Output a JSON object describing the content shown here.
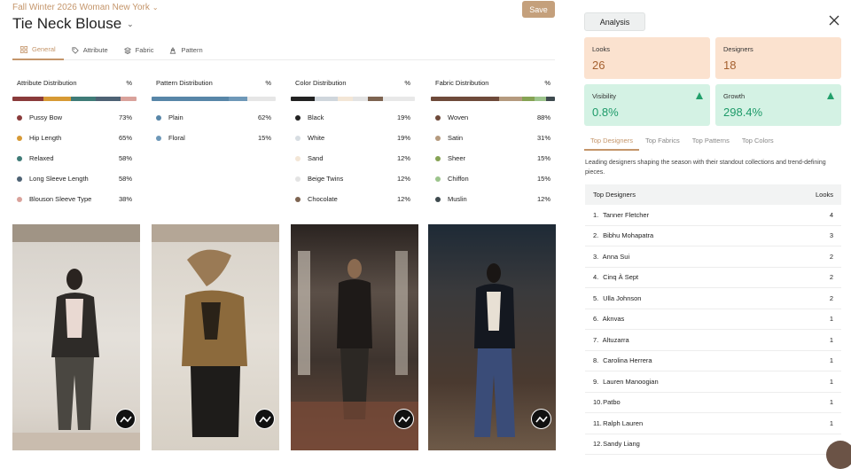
{
  "breadcrumb": "Fall Winter 2026 Woman New York",
  "title": "Tie Neck Blouse",
  "save_label": "Save",
  "tabs": [
    {
      "label": "General",
      "icon": "grid-icon",
      "active": true
    },
    {
      "label": "Attribute",
      "icon": "tag-icon",
      "active": false
    },
    {
      "label": "Fabric",
      "icon": "layers-icon",
      "active": false
    },
    {
      "label": "Pattern",
      "icon": "pattern-icon",
      "active": false
    }
  ],
  "distributions": [
    {
      "title": "Attribute Distribution",
      "pct_header": "%",
      "items": [
        {
          "label": "Pussy Bow",
          "value": "73%",
          "color": "#8a3b3b"
        },
        {
          "label": "Hip Length",
          "value": "65%",
          "color": "#d79a35"
        },
        {
          "label": "Relaxed",
          "value": "58%",
          "color": "#3f7b77"
        },
        {
          "label": "Long Sleeve Length",
          "value": "58%",
          "color": "#4e6274"
        },
        {
          "label": "Blouson Sleeve Type",
          "value": "38%",
          "color": "#d9a29b"
        }
      ]
    },
    {
      "title": "Pattern Distribution",
      "pct_header": "%",
      "items": [
        {
          "label": "Plain",
          "value": "62%",
          "color": "#5886a8"
        },
        {
          "label": "Floral",
          "value": "15%",
          "color": "#6e98b8"
        }
      ]
    },
    {
      "title": "Color Distribution",
      "pct_header": "%",
      "items": [
        {
          "label": "Black",
          "value": "19%",
          "color": "#222222"
        },
        {
          "label": "White",
          "value": "19%",
          "color": "#d7dde2"
        },
        {
          "label": "Sand",
          "value": "12%",
          "color": "#f3e6d6"
        },
        {
          "label": "Beige Twins",
          "value": "12%",
          "color": "#e3e3e3"
        },
        {
          "label": "Chocolate",
          "value": "12%",
          "color": "#7d6451"
        }
      ]
    },
    {
      "title": "Fabric Distribution",
      "pct_header": "%",
      "items": [
        {
          "label": "Woven",
          "value": "88%",
          "color": "#6e4a3a"
        },
        {
          "label": "Satin",
          "value": "31%",
          "color": "#b59a7e"
        },
        {
          "label": "Sheer",
          "value": "15%",
          "color": "#86a354"
        },
        {
          "label": "Chiffon",
          "value": "15%",
          "color": "#9cc48c"
        },
        {
          "label": "Muslin",
          "value": "12%",
          "color": "#3e4a4e"
        }
      ]
    }
  ],
  "panel": {
    "tab_label": "Analysis",
    "cards": {
      "looks": {
        "label": "Looks",
        "value": "26"
      },
      "designers": {
        "label": "Designers",
        "value": "18"
      },
      "visibility": {
        "label": "Visibility",
        "value": "0.8%"
      },
      "growth": {
        "label": "Growth",
        "value": "298.4%"
      }
    },
    "subtabs": [
      "Top Designers",
      "Top Fabrics",
      "Top Patterns",
      "Top Colors"
    ],
    "description": "Leading designers shaping the season with their standout collections and trend-defining pieces.",
    "table": {
      "col_designers": "Top Designers",
      "col_looks": "Looks",
      "rows": [
        {
          "rank": "1.",
          "name": "Tanner Fletcher",
          "looks": "4"
        },
        {
          "rank": "2.",
          "name": "Bibhu Mohapatra",
          "looks": "3"
        },
        {
          "rank": "3.",
          "name": "Anna Sui",
          "looks": "2"
        },
        {
          "rank": "4.",
          "name": "Cinq À Sept",
          "looks": "2"
        },
        {
          "rank": "5.",
          "name": "Ulla Johnson",
          "looks": "2"
        },
        {
          "rank": "6.",
          "name": "Aknvas",
          "looks": "1"
        },
        {
          "rank": "7.",
          "name": "Altuzarra",
          "looks": "1"
        },
        {
          "rank": "8.",
          "name": "Carolina Herrera",
          "looks": "1"
        },
        {
          "rank": "9.",
          "name": "Lauren Manoogian",
          "looks": "1"
        },
        {
          "rank": "10.",
          "name": "Patbo",
          "looks": "1"
        },
        {
          "rank": "11.",
          "name": "Ralph Lauren",
          "looks": "1"
        },
        {
          "rank": "12.",
          "name": "Sandy Liang",
          "looks": ""
        }
      ]
    }
  }
}
